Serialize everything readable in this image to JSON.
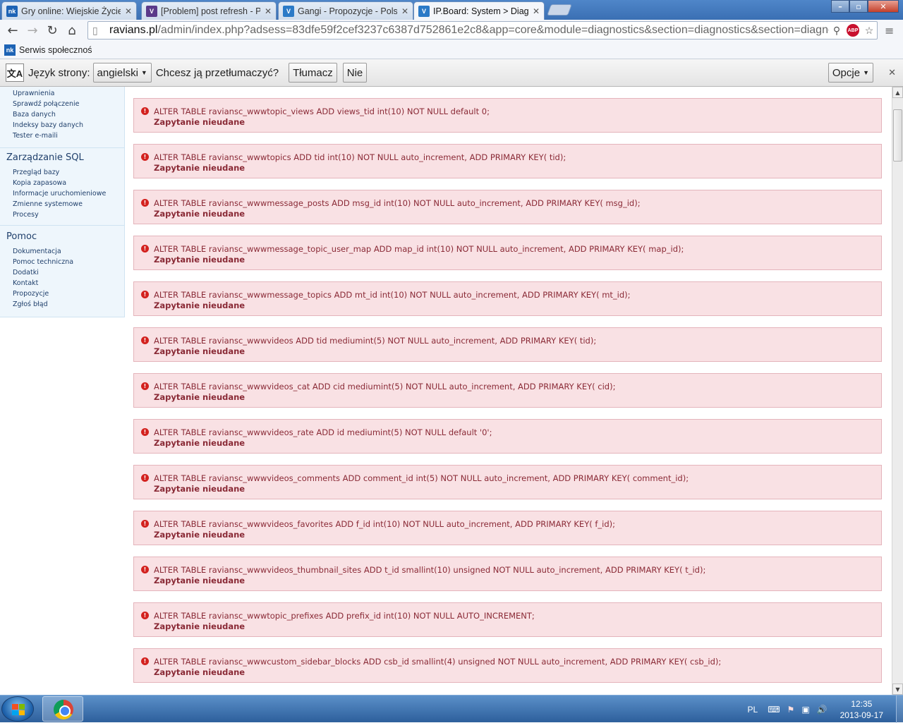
{
  "browser": {
    "tabs": [
      {
        "icon": "nk",
        "title": "Gry online: Wiejskie Życie",
        "color": "#1d63b5"
      },
      {
        "icon": "V",
        "title": "[Problem] post refresh - P",
        "color": "#5b3a8a"
      },
      {
        "icon": "V",
        "title": "Gangi - Propozycje - Polsk",
        "color": "#2b7ac7"
      },
      {
        "icon": "V",
        "title": "IP.Board: System > Diagno",
        "color": "#2b7ac7"
      }
    ],
    "url_host": "ravians.pl",
    "url_path": "/admin/index.php?adsess=83dfe59f2cef3237c6387d752861e2c8&app=core&module=diagnostics&section=diagnostics&section=diagno",
    "abp_label": "ABP",
    "bookmark": {
      "icon": "nk",
      "label": "Serwis społecznoś"
    }
  },
  "translate_bar": {
    "icon_label": "文A",
    "page_lang_label": "Język strony:",
    "lang_value": "angielski",
    "question": "Chcesz ją przetłumaczyć?",
    "translate_btn": "Tłumacz",
    "no_btn": "Nie",
    "options_btn": "Opcje"
  },
  "sidebar": {
    "top_items": [
      "Uprawnienia",
      "Sprawdź połączenie",
      "Baza danych",
      "Indeksy bazy danych",
      "Tester e-maili"
    ],
    "sql_heading": "Zarządzanie SQL",
    "sql_items": [
      "Przegląd bazy",
      "Kopia zapasowa",
      "Informacje uruchomieniowe",
      "Zmienne systemowe",
      "Procesy"
    ],
    "help_heading": "Pomoc",
    "help_items": [
      "Dokumentacja",
      "Pomoc techniczna",
      "Dodatki",
      "Kontakt",
      "Propozycje",
      "Zgłoś błąd"
    ]
  },
  "errors": [
    {
      "query": "ALTER TABLE raviansc_wwwtopic_views ADD views_tid int(10) NOT NULL default 0;",
      "status": "Zapytanie nieudane"
    },
    {
      "query": "ALTER TABLE raviansc_wwwtopics ADD tid int(10) NOT NULL auto_increment, ADD PRIMARY KEY( tid);",
      "status": "Zapytanie nieudane"
    },
    {
      "query": "ALTER TABLE raviansc_wwwmessage_posts ADD msg_id int(10) NOT NULL auto_increment, ADD PRIMARY KEY( msg_id);",
      "status": "Zapytanie nieudane"
    },
    {
      "query": "ALTER TABLE raviansc_wwwmessage_topic_user_map ADD map_id int(10) NOT NULL auto_increment, ADD PRIMARY KEY( map_id);",
      "status": "Zapytanie nieudane"
    },
    {
      "query": "ALTER TABLE raviansc_wwwmessage_topics ADD mt_id int(10) NOT NULL auto_increment, ADD PRIMARY KEY( mt_id);",
      "status": "Zapytanie nieudane"
    },
    {
      "query": "ALTER TABLE raviansc_wwwvideos ADD tid mediumint(5) NOT NULL auto_increment, ADD PRIMARY KEY( tid);",
      "status": "Zapytanie nieudane"
    },
    {
      "query": "ALTER TABLE raviansc_wwwvideos_cat ADD cid mediumint(5) NOT NULL auto_increment, ADD PRIMARY KEY( cid);",
      "status": "Zapytanie nieudane"
    },
    {
      "query": "ALTER TABLE raviansc_wwwvideos_rate ADD id mediumint(5) NOT NULL default '0';",
      "status": "Zapytanie nieudane"
    },
    {
      "query": "ALTER TABLE raviansc_wwwvideos_comments ADD comment_id int(5) NOT NULL auto_increment, ADD PRIMARY KEY( comment_id);",
      "status": "Zapytanie nieudane"
    },
    {
      "query": "ALTER TABLE raviansc_wwwvideos_favorites ADD f_id int(10) NOT NULL auto_increment, ADD PRIMARY KEY( f_id);",
      "status": "Zapytanie nieudane"
    },
    {
      "query": "ALTER TABLE raviansc_wwwvideos_thumbnail_sites ADD t_id smallint(10) unsigned NOT NULL auto_increment, ADD PRIMARY KEY( t_id);",
      "status": "Zapytanie nieudane"
    },
    {
      "query": "ALTER TABLE raviansc_wwwtopic_prefixes ADD prefix_id int(10) NOT NULL AUTO_INCREMENT;",
      "status": "Zapytanie nieudane"
    },
    {
      "query": "ALTER TABLE raviansc_wwwcustom_sidebar_blocks ADD csb_id smallint(4) unsigned NOT NULL auto_increment, ADD PRIMARY KEY( csb_id);",
      "status": "Zapytanie nieudane"
    }
  ],
  "taskbar": {
    "lang": "PL",
    "time": "12:35",
    "date": "2013-09-17"
  },
  "colors": {
    "error_bg": "#f9e1e4",
    "error_border": "#e4b4bb",
    "error_text": "#8a2a36",
    "sidebar_bg": "#eef6fc"
  }
}
